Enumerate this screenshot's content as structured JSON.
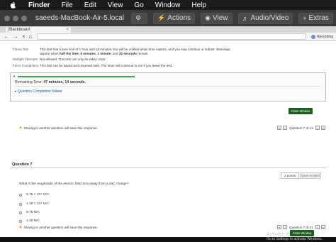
{
  "menubar": {
    "app": "Finder",
    "items": [
      "File",
      "Edit",
      "View",
      "Go",
      "Window",
      "Help"
    ]
  },
  "toolbar": {
    "host": "saeeds-MacBook-Air-5.local",
    "actions": "Actions",
    "view": "View",
    "audio_video": "Audio/Video",
    "extras": "Extras"
  },
  "browser": {
    "tab_title": "Blackboard",
    "user": "Recording"
  },
  "info": [
    {
      "k": "Timed Test",
      "v": "This test has a time limit of 1 hour and 15 minutes.You will be notified when time expires, and you may continue or submit. Warnings appear when half the time, 5 minutes, 1 minute, and 30 seconds remain."
    },
    {
      "k": "Multiple Attempts",
      "v": "Not allowed. This test can only be taken once."
    },
    {
      "k": "Force Completion",
      "v": "This test can be saved and resumed later. The timer will continue to run if you leave the test."
    }
  ],
  "timer": {
    "progress": 0.37,
    "label": "Remaining Time:",
    "value": "47 minutes, 14 seconds.",
    "completion_status": "Question Completion Status:"
  },
  "close_window": "Close Window",
  "warning": "Moving to another question will save this response.",
  "pager": {
    "label": "Question 7 of 21"
  },
  "question": {
    "title": "Question 7",
    "points": "2 points",
    "save": "Save Answer",
    "text": "What is the magnitude of the electric field 2cm away from a 3nC charge?",
    "options": [
      "6.75 × 10⁴ N/C",
      "1.35 × 10⁴ N/C",
      "6.75 N/C",
      "1.35 N/C"
    ]
  },
  "watermark": {
    "line1": "Activate Windows",
    "line2": "Go to Settings to activate Windows."
  }
}
